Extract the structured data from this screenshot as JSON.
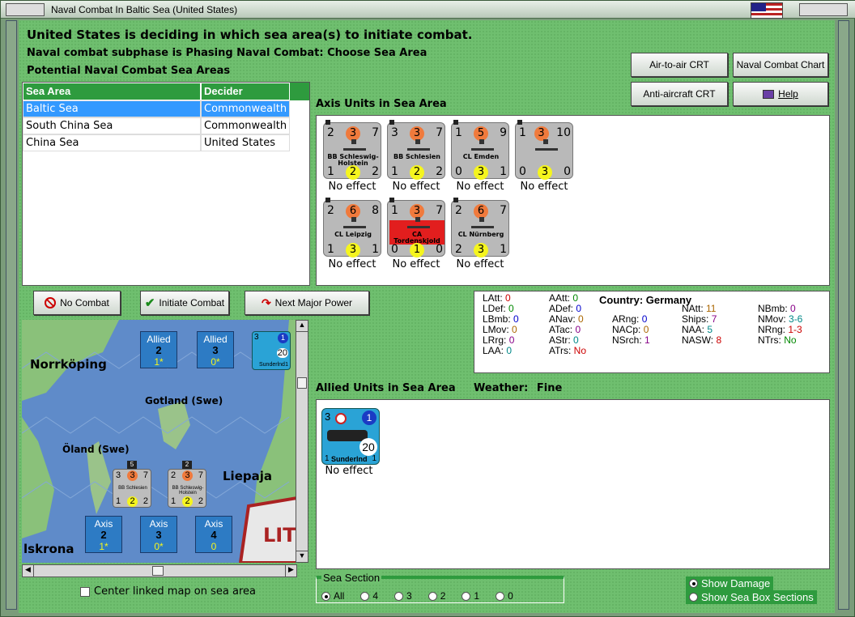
{
  "window": {
    "title": "Naval Combat In Baltic Sea (United States)"
  },
  "header": {
    "line1": "United States is deciding in which sea area(s) to initiate combat.",
    "line2": "Naval combat subphase is Phasing Naval Combat: Choose Sea Area",
    "line3": "Potential Naval Combat Sea Areas"
  },
  "buttons": {
    "air_to_air": "Air-to-air CRT",
    "naval_chart": "Naval Combat Chart",
    "anti_aircraft": "Anti-aircraft CRT",
    "help": "Help",
    "no_combat": "No Combat",
    "initiate": "Initiate Combat",
    "next_major": "Next Major Power"
  },
  "sea_table": {
    "headers": [
      "Sea Area",
      "Decider"
    ],
    "rows": [
      [
        "Baltic Sea",
        "Commonwealth"
      ],
      [
        "South China Sea",
        "Commonwealth"
      ],
      [
        "China Sea",
        "United States"
      ]
    ]
  },
  "axis": {
    "label": "Axis Units in Sea Area",
    "units": [
      {
        "name": "BB Schleswig-Holstein",
        "top": [
          "2",
          "3",
          "7"
        ],
        "bot": [
          "1",
          "2",
          "2"
        ],
        "effect": "No effect"
      },
      {
        "name": "BB Schlesien",
        "top": [
          "3",
          "3",
          "7"
        ],
        "bot": [
          "1",
          "2",
          "2"
        ],
        "effect": "No effect"
      },
      {
        "name": "CL Emden",
        "top": [
          "1",
          "5",
          "9"
        ],
        "bot": [
          "0",
          "3",
          "1"
        ],
        "effect": "No effect"
      },
      {
        "name": "",
        "top": [
          "1",
          "3",
          "10"
        ],
        "bot": [
          "0",
          "3",
          "0"
        ],
        "effect": "No effect"
      },
      {
        "name": "CL Leipzig",
        "top": [
          "2",
          "6",
          "8"
        ],
        "bot": [
          "1",
          "3",
          "1"
        ],
        "effect": "No effect"
      },
      {
        "name": "CA Tordenskjold",
        "top": [
          "1",
          "3",
          "7"
        ],
        "bot": [
          "0",
          "1",
          "0"
        ],
        "effect": "No effect"
      },
      {
        "name": "CL Nürnberg",
        "top": [
          "2",
          "6",
          "7"
        ],
        "bot": [
          "2",
          "3",
          "1"
        ],
        "effect": "No effect"
      }
    ]
  },
  "stats": {
    "country_label": "Country:",
    "country": "Germany",
    "col1": [
      [
        "LAtt:",
        "0"
      ],
      [
        "LDef:",
        "0"
      ],
      [
        "LBmb:",
        "0"
      ],
      [
        "LMov:",
        "0"
      ],
      [
        "LRrg:",
        "0"
      ],
      [
        "LAA:",
        "0"
      ]
    ],
    "col2": [
      [
        "AAtt:",
        "0"
      ],
      [
        "ADef:",
        "0"
      ],
      [
        "ANav:",
        "0"
      ],
      [
        "ATac:",
        "0"
      ],
      [
        "AStr:",
        "0"
      ],
      [
        "ATrs:",
        "No"
      ]
    ],
    "col3": [
      [
        "ARng:",
        "0"
      ],
      [
        "NACp:",
        "0"
      ],
      [
        "NSrch:",
        "1"
      ]
    ],
    "col4": [
      [
        "NAtt:",
        "11"
      ],
      [
        "Ships:",
        "7"
      ],
      [
        "NAA:",
        "5"
      ],
      [
        "NASW:",
        "8"
      ]
    ],
    "col5": [
      [
        "NBmb:",
        "0"
      ],
      [
        "NMov:",
        "3-6"
      ],
      [
        "NRng:",
        "1-3"
      ],
      [
        "NTrs:",
        "No"
      ]
    ]
  },
  "allied": {
    "label": "Allied Units in Sea Area",
    "weather_label": "Weather:",
    "weather": "Fine",
    "unit": {
      "name": "Sunderlnd",
      "tl": "3",
      "tr": "1",
      "br": "20",
      "bl": "1",
      "b_r": "1",
      "effect": "No effect"
    }
  },
  "map": {
    "places": [
      "Norrköping",
      "Gotland (Swe)",
      "Öland (Swe)",
      "Liepaja",
      "lskrona",
      "LIT"
    ],
    "allied_boxes": [
      {
        "label": "Allied",
        "num": "2",
        "sub": "1*"
      },
      {
        "label": "Allied",
        "num": "3",
        "sub": "0*"
      }
    ],
    "axis_boxes": [
      {
        "label": "Axis",
        "num": "2",
        "sub": "1*"
      },
      {
        "label": "Axis",
        "num": "3",
        "sub": "0*"
      },
      {
        "label": "Axis",
        "num": "4",
        "sub": "0"
      }
    ],
    "stack_counts": [
      "5",
      "2"
    ],
    "unit_top": "3",
    "unit_num": "1",
    "unit_val": "20",
    "unit_name": "Sunderlnd",
    "unit_br": "1",
    "mini_units": [
      {
        "name": "BB Schlesien",
        "top": [
          "3",
          "3",
          "7"
        ],
        "bot": [
          "1",
          "2",
          "2"
        ]
      },
      {
        "name": "BB Schleswig-Holstein",
        "top": [
          "2",
          "3",
          "7"
        ],
        "bot": [
          "1",
          "2",
          "2"
        ]
      }
    ]
  },
  "center_checkbox": "Center linked map on sea area",
  "sea_section": {
    "label": "Sea Section",
    "options": [
      "All",
      "4",
      "3",
      "2",
      "1",
      "0"
    ]
  },
  "options": {
    "show_damage": "Show Damage",
    "show_sections": "Show Sea Box Sections"
  },
  "colors": {
    "accent_green": "#2e9b3e",
    "selection_blue": "#3399ff",
    "felt_green": "#6fbf6f"
  }
}
